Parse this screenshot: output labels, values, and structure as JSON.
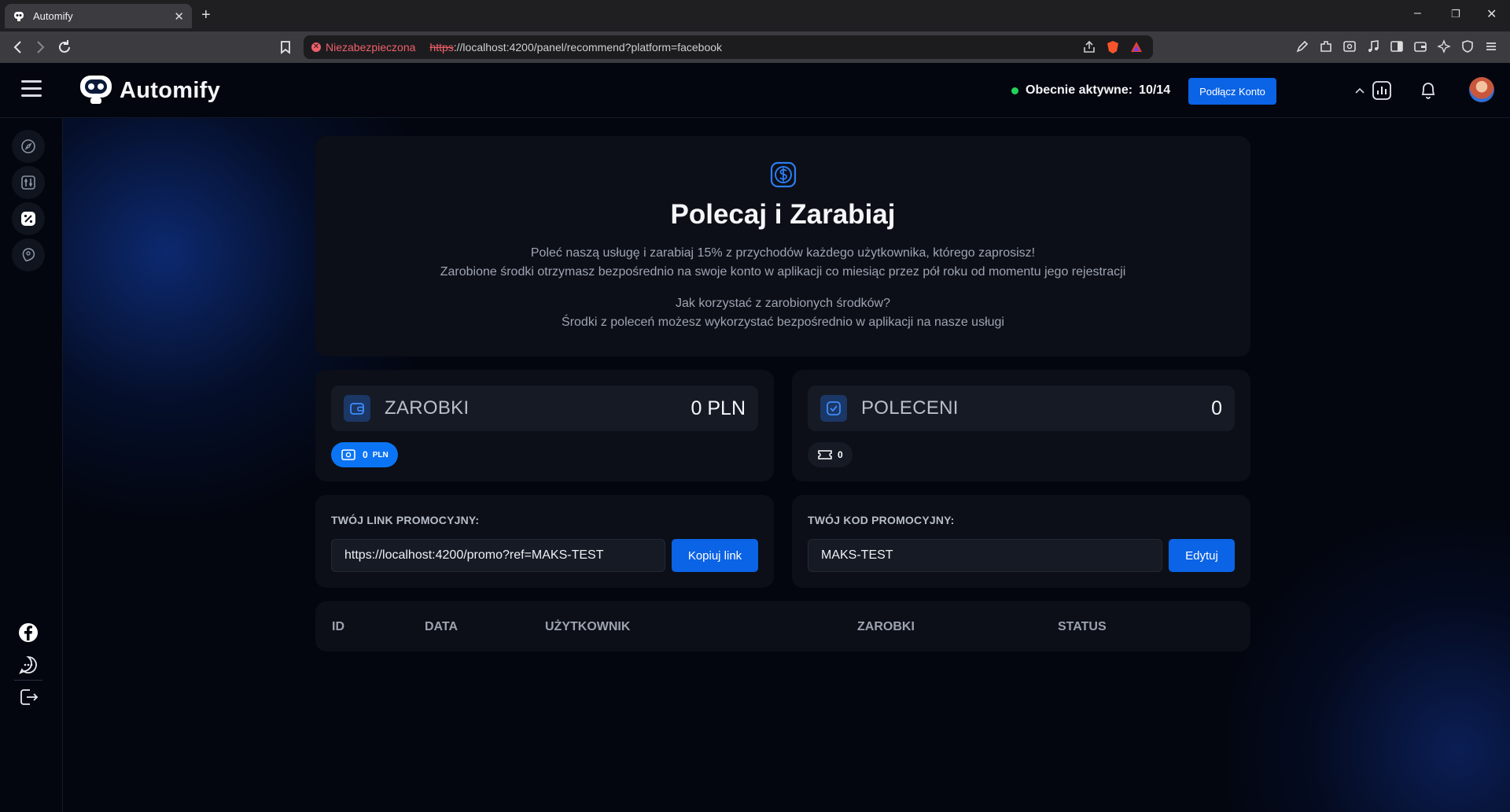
{
  "browser": {
    "tab_title": "Automify",
    "new_tab": "+",
    "win_minimize": "–",
    "win_restore": "❐",
    "win_close": "✕",
    "security_label": "Niezabezpieczona",
    "url_scheme": "https",
    "url_rest": "://localhost:4200/panel/recommend?platform=facebook"
  },
  "header": {
    "brand": "Automify",
    "active_label": "Obecnie aktywne:",
    "active_value": "10/14",
    "connect_button": "Podłącz Konto"
  },
  "hero": {
    "title": "Polecaj i Zarabiaj",
    "line1": "Poleć naszą usługę i zarabiaj 15% z przychodów każdego użytkownika, którego zaprosisz!",
    "line2": "Zarobione środki otrzymasz bezpośrednio na swoje konto w aplikacji co miesiąc przez pół roku od momentu jego rejestracji",
    "line3": "Jak korzystać z zarobionych środków?",
    "line4": "Środki z poleceń możesz wykorzystać bezpośrednio w aplikacji na nasze usługi"
  },
  "earnings": {
    "label": "ZAROBKI",
    "value": "0 PLN",
    "pill_value": "0",
    "pill_unit": "PLN"
  },
  "referrals": {
    "label": "POLECENI",
    "value": "0",
    "pill_value": "0"
  },
  "promo_link": {
    "label": "TWÓJ LINK PROMOCYJNY:",
    "value": "https://localhost:4200/promo?ref=MAKS-TEST",
    "button": "Kopiuj link"
  },
  "promo_code": {
    "label": "TWÓJ KOD PROMOCYJNY:",
    "value": "MAKS-TEST",
    "button": "Edytuj"
  },
  "table": {
    "columns": [
      "ID",
      "DATA",
      "UŻYTKOWNIK",
      "ZAROBKI",
      "STATUS"
    ]
  },
  "colors": {
    "accent": "#0b63e5",
    "accent_bright": "#0b74f5",
    "status_active": "#22d35b",
    "card_bg": "#0c0f17",
    "page_bg": "#03060f"
  }
}
